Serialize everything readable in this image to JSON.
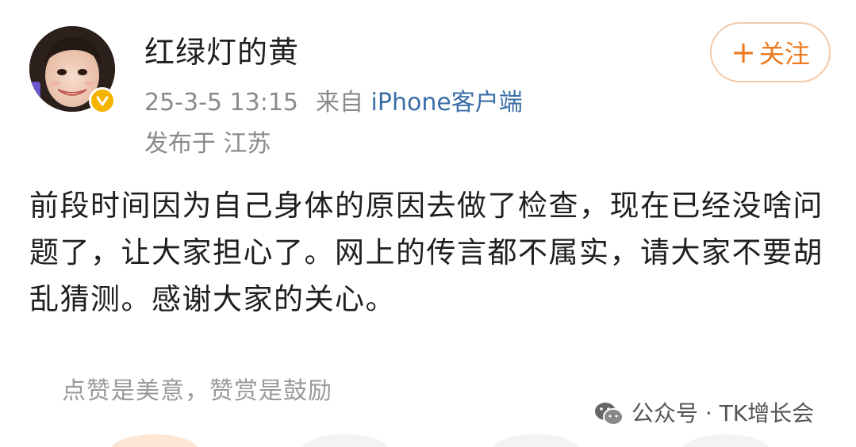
{
  "author": {
    "name": "红绿灯的黄"
  },
  "follow_button": {
    "icon": "plus-icon",
    "plus": "+",
    "label": "关注"
  },
  "meta": {
    "timestamp": "25-3-5 13:15",
    "from_prefix": "来自",
    "source": "iPhone客户端",
    "location": "发布于 江苏"
  },
  "post": {
    "text": "前段时间因为自己身体的原因去做了检查，现在已经没啥问题了，让大家担心了。网上的传言都不属实，请大家不要胡乱猜测。感谢大家的关心。"
  },
  "reward": {
    "slogan": "点赞是美意，赞赏是鼓励"
  },
  "watermark": {
    "icon": "wechat-icon",
    "text": "公众号 · TK增长会"
  },
  "colors": {
    "accent": "#ee7a1f",
    "link": "#3b6ea8",
    "badge": "#f5b400"
  }
}
